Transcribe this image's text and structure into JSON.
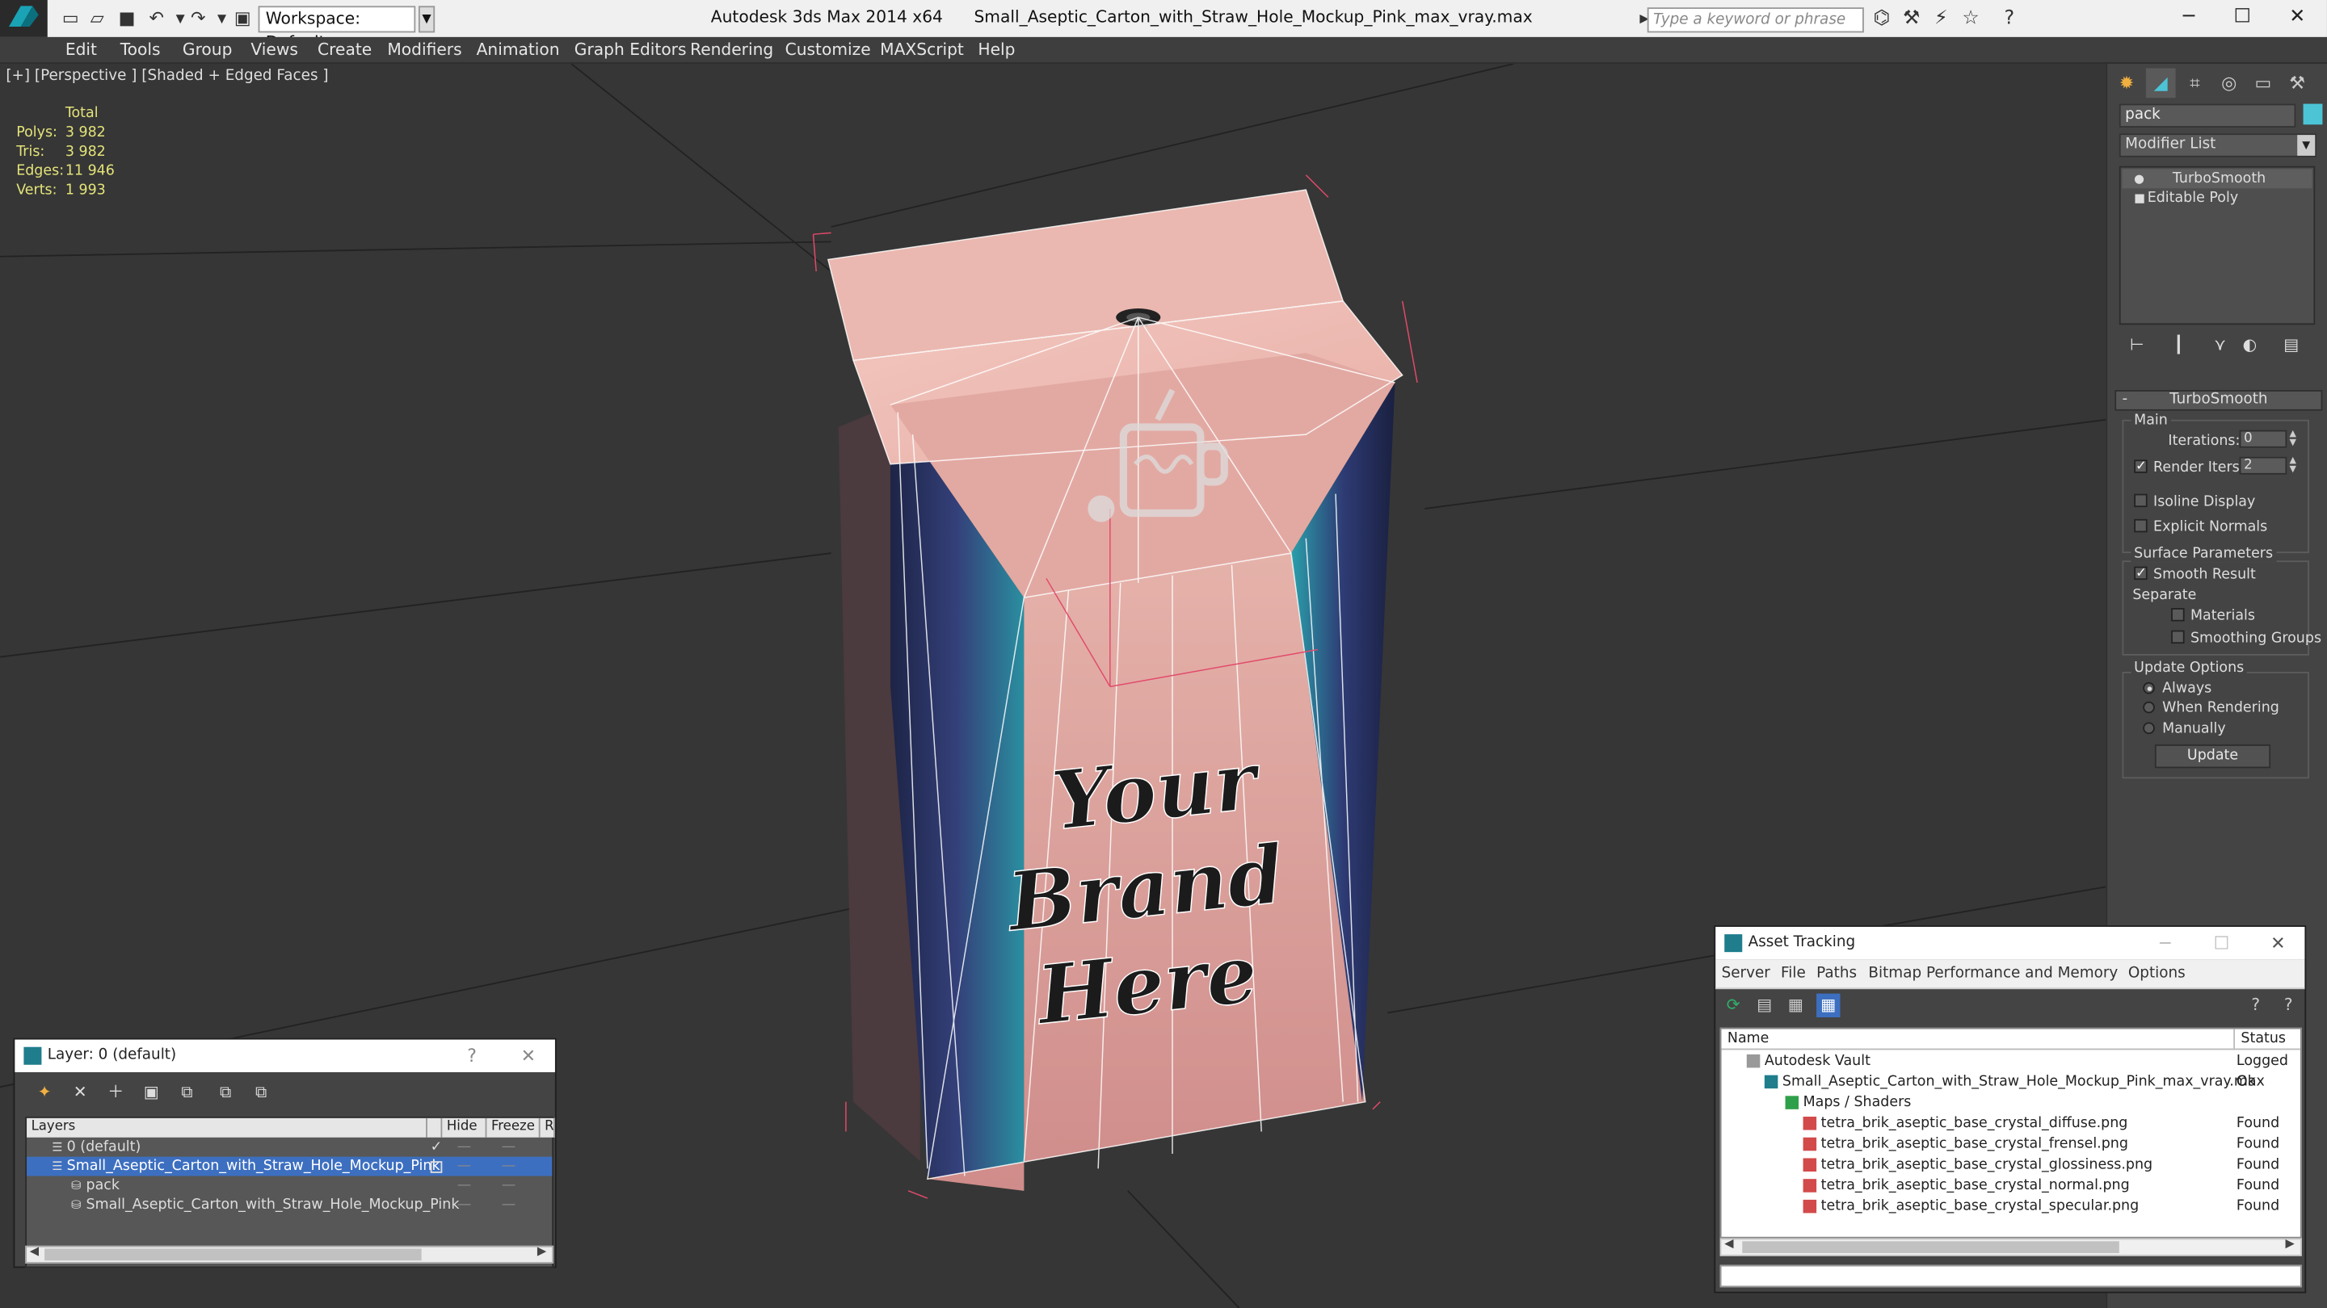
{
  "app": {
    "title": "Autodesk 3ds Max 2014 x64",
    "file": "Small_Aseptic_Carton_with_Straw_Hole_Mockup_Pink_max_vray.max",
    "workspace": "Workspace: Default",
    "search_placeholder": "Type a keyword or phrase"
  },
  "menu": [
    "Edit",
    "Tools",
    "Group",
    "Views",
    "Create",
    "Modifiers",
    "Animation",
    "Graph Editors",
    "Rendering",
    "Customize",
    "MAXScript",
    "Help"
  ],
  "viewport": {
    "label": "[+] [Perspective ] [Shaded + Edged Faces ]",
    "stats_header": "Total",
    "stats": [
      {
        "k": "Polys:",
        "v": "3 982"
      },
      {
        "k": "Tris:",
        "v": "3 982"
      },
      {
        "k": "Edges:",
        "v": "11 946"
      },
      {
        "k": "Verts:",
        "v": "1 993"
      }
    ],
    "carton_text": [
      "Your",
      "Brand",
      "Here"
    ]
  },
  "command_panel": {
    "object_name": "pack",
    "object_color": "#4cc4d6",
    "modifier_list": "Modifier List",
    "stack": [
      "TurboSmooth",
      "Editable Poly"
    ],
    "rollout": "TurboSmooth",
    "main": {
      "title": "Main",
      "iterations_label": "Iterations:",
      "iterations": "0",
      "render_iters_label": "Render Iters:",
      "render_iters": "2",
      "isoline": "Isoline Display",
      "explicit": "Explicit Normals"
    },
    "surface": {
      "title": "Surface Parameters",
      "smooth": "Smooth Result",
      "separate": "Separate",
      "materials": "Materials",
      "smoothing": "Smoothing Groups"
    },
    "update": {
      "title": "Update Options",
      "always": "Always",
      "rendering": "When Rendering",
      "manually": "Manually",
      "button": "Update"
    }
  },
  "layers": {
    "title": "Layer: 0 (default)",
    "cols": [
      "Layers",
      "Hide",
      "Freeze",
      "R"
    ],
    "rows": [
      "0 (default)",
      "Small_Aseptic_Carton_with_Straw_Hole_Mockup_Pink",
      "pack",
      "Small_Aseptic_Carton_with_Straw_Hole_Mockup_Pink"
    ]
  },
  "asset": {
    "title": "Asset Tracking",
    "menu": [
      "Server",
      "File",
      "Paths",
      "Bitmap Performance and Memory",
      "Options"
    ],
    "cols": [
      "Name",
      "Status"
    ],
    "rows": [
      {
        "name": "Autodesk Vault",
        "status": "Logged C"
      },
      {
        "name": "Small_Aseptic_Carton_with_Straw_Hole_Mockup_Pink_max_vray.max",
        "status": "Ok"
      },
      {
        "name": "Maps / Shaders",
        "status": ""
      },
      {
        "name": "tetra_brik_aseptic_base_crystal_diffuse.png",
        "status": "Found"
      },
      {
        "name": "tetra_brik_aseptic_base_crystal_frensel.png",
        "status": "Found"
      },
      {
        "name": "tetra_brik_aseptic_base_crystal_glossiness.png",
        "status": "Found"
      },
      {
        "name": "tetra_brik_aseptic_base_crystal_normal.png",
        "status": "Found"
      },
      {
        "name": "tetra_brik_aseptic_base_crystal_specular.png",
        "status": "Found"
      }
    ]
  }
}
